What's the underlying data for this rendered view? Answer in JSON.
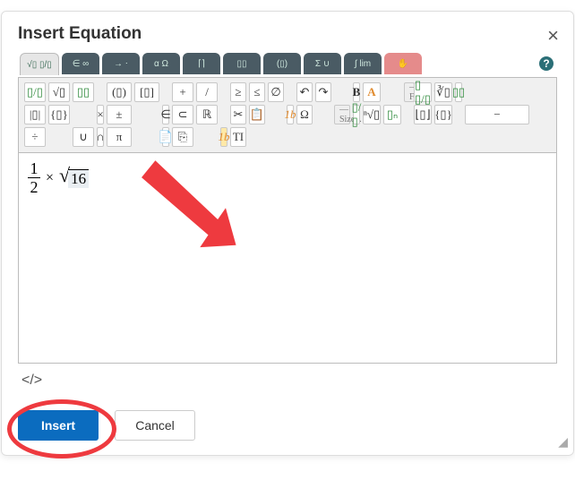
{
  "dialog": {
    "title": "Insert Equation",
    "close_label": "×"
  },
  "help_label": "?",
  "tabs": [
    {
      "icon": "√▯ ▯/▯"
    },
    {
      "icon": "∈ ∞"
    },
    {
      "icon": "→ ⋅"
    },
    {
      "icon": "α Ω"
    },
    {
      "icon": "⌈⌉"
    },
    {
      "icon": "▯▯"
    },
    {
      "icon": "(▯)"
    },
    {
      "icon": "Σ ∪"
    },
    {
      "icon": "∫ lim"
    },
    {
      "icon": "✋"
    }
  ],
  "palette": {
    "r1": {
      "c1": "▯/▯",
      "c2": "√▯",
      "c3": "▯▯",
      "c4": "(▯)",
      "c5": "[▯]",
      "c6": "+",
      "c7": "/",
      "c8": "≥",
      "c9": "≤",
      "c10": "∅",
      "c11": "↶",
      "c12": "↷",
      "c13": "B",
      "c14": "A",
      "dd1": "— Fon..."
    },
    "r2": {
      "c1": "▯ ▯/▯",
      "c2": "∛▯",
      "c3": "▯▯",
      "c4": "|▯|",
      "c5": "{▯}",
      "c6": "×",
      "c7": "±",
      "c8": "∈",
      "c9": "⊂",
      "c10": "ℝ",
      "c11": "✂",
      "c12": "📋",
      "c13": "1b",
      "c14": "Ω",
      "dd2": "— Size..."
    },
    "r3": {
      "c1": "▯/▯",
      "c2": "ⁿ√▯",
      "c3": "▯ₙ",
      "c4": "⌊▯⌋",
      "c5": "{▯}",
      "c6": "−",
      "c7": "÷",
      "c8": "∪",
      "c9": "∩",
      "c10": "π",
      "c11": "📄",
      "c12": "⎘",
      "c13": "1b",
      "c14": "TI"
    }
  },
  "equation": {
    "numerator": "1",
    "denominator": "2",
    "operator": "×",
    "radicand": "16"
  },
  "footer": {
    "code_toggle": "</>",
    "insert": "Insert",
    "cancel": "Cancel",
    "resize": "⋰"
  },
  "colors": {
    "primary": "#0b6cbf",
    "annotate": "#ee3a3f"
  }
}
